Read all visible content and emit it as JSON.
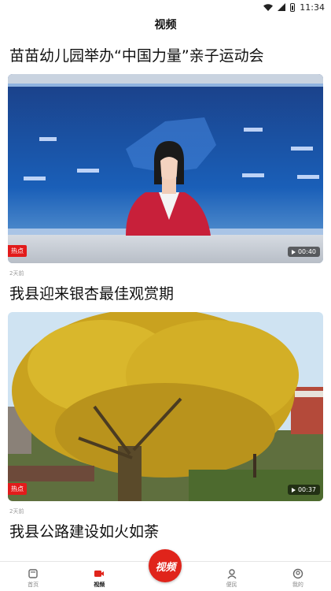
{
  "status": {
    "time": "11:34"
  },
  "header": {
    "title": "视频"
  },
  "feed": {
    "items": [
      {
        "title": "苗苗幼儿园举办“中国力量”亲子运动会",
        "tag": "热点",
        "duration": "00:40",
        "age": "2天前"
      },
      {
        "title": "我县迎来银杏最佳观赏期",
        "tag": "热点",
        "duration": "00:37",
        "age": "2天前"
      },
      {
        "title": "我县公路建设如火如荼"
      }
    ]
  },
  "tabbar": {
    "items": [
      {
        "label": "首页",
        "icon": "home-icon"
      },
      {
        "label": "视频",
        "icon": "video-icon"
      },
      {
        "center_label": "视频",
        "icon": "video-badge"
      },
      {
        "label": "便民",
        "icon": "service-icon"
      },
      {
        "label": "我的",
        "icon": "profile-icon"
      }
    ]
  },
  "colors": {
    "accent": "#e0241b",
    "tag": "#e21b1b"
  }
}
